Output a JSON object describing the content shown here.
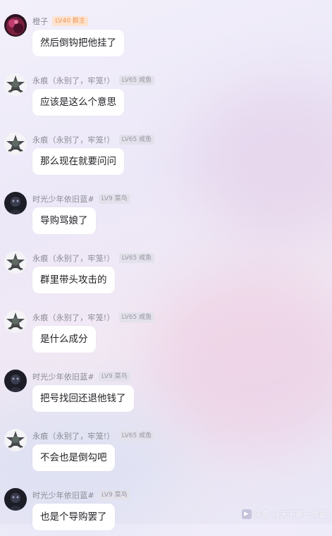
{
  "messages": [
    {
      "user": "橙子",
      "badge": "LV40 群主",
      "badge_style": "orange",
      "avatar": "orange-avatar",
      "text": "然后倒钩把他挂了"
    },
    {
      "user": "永痕（永别了，牢笼!）",
      "badge": "LV65 咸鱼",
      "badge_style": "gray",
      "avatar": "ink-avatar",
      "text": "应该是这么个意思"
    },
    {
      "user": "永痕（永别了，牢笼!）",
      "badge": "LV65 咸鱼",
      "badge_style": "gray",
      "avatar": "ink-avatar",
      "text": "那么现在就要问问"
    },
    {
      "user": "时光少年依旧蓝#",
      "badge": "LV9 菜鸟",
      "badge_style": "gray",
      "avatar": "dark-avatar",
      "text": "导购骂娘了"
    },
    {
      "user": "永痕（永别了，牢笼!）",
      "badge": "LV65 咸鱼",
      "badge_style": "gray",
      "avatar": "ink-avatar",
      "text": "群里带头攻击的"
    },
    {
      "user": "永痕（永别了，牢笼!）",
      "badge": "LV65 咸鱼",
      "badge_style": "gray",
      "avatar": "ink-avatar",
      "text": "是什么成分"
    },
    {
      "user": "时光少年依旧蓝#",
      "badge": "LV9 菜鸟",
      "badge_style": "gray",
      "avatar": "dark-avatar",
      "text": "把号找回还退他钱了"
    },
    {
      "user": "永痕（永别了，牢笼!）",
      "badge": "LV65 咸鱼",
      "badge_style": "gray",
      "avatar": "ink-avatar",
      "text": "不会也是倒勾吧"
    },
    {
      "user": "时光少年依旧蓝#",
      "badge": "LV9 菜鸟",
      "badge_style": "gray",
      "avatar": "dark-avatar",
      "text": "也是个导购罢了"
    }
  ],
  "watermark": "头条 @天下第一帅逼"
}
